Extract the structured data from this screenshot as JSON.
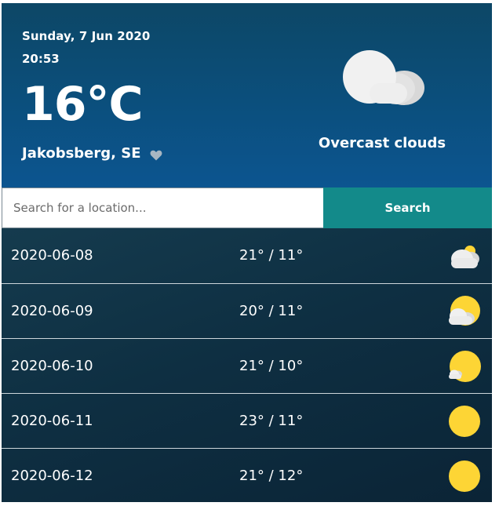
{
  "current": {
    "date": "Sunday, 7 Jun 2020",
    "time": "20:53",
    "temperature": "16°C",
    "location": "Jakobsberg, SE",
    "condition": "Overcast clouds",
    "icon": "overcast-clouds-icon",
    "favorite_icon": "heart-icon"
  },
  "search": {
    "placeholder": "Search for a location...",
    "value": "",
    "button_label": "Search"
  },
  "forecast": [
    {
      "date": "2020-06-08",
      "temps": "21° / 11°",
      "icon": "sun-behind-clouds-icon"
    },
    {
      "date": "2020-06-09",
      "temps": "20° / 11°",
      "icon": "sun-with-cloud-icon"
    },
    {
      "date": "2020-06-10",
      "temps": "21° / 10°",
      "icon": "sun-small-cloud-icon"
    },
    {
      "date": "2020-06-11",
      "temps": "23° / 11°",
      "icon": "sun-icon"
    },
    {
      "date": "2020-06-12",
      "temps": "21° / 12°",
      "icon": "sun-icon"
    }
  ],
  "colors": {
    "header_top": "#0d4766",
    "header_bottom": "#0c5590",
    "search_button": "#138a8a",
    "forecast_bg": "#0e2f42",
    "sun": "#fdd535",
    "cloud": "#eeeeee"
  }
}
